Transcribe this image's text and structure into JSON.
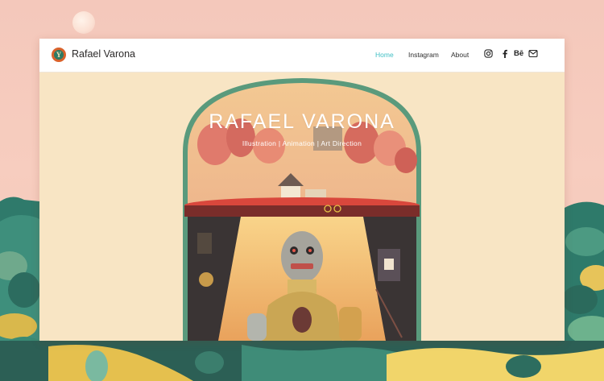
{
  "header": {
    "brand_name": "Rafael Varona",
    "logo_letter": "Y"
  },
  "nav": {
    "items": [
      {
        "label": "Home",
        "active": true
      },
      {
        "label": "Instagram",
        "active": false
      },
      {
        "label": "About",
        "active": false
      }
    ]
  },
  "social": {
    "icons": [
      "instagram-icon",
      "facebook-icon",
      "behance-icon",
      "mail-icon"
    ],
    "behance_label": "Bē"
  },
  "hero": {
    "title": "RAFAEL VARONA",
    "subtitle": "Illustration | Animation | Art Direction"
  },
  "colors": {
    "accent": "#3fbfc4",
    "background": "#f7cdbf",
    "hero_bg": "#f8e5c4"
  }
}
